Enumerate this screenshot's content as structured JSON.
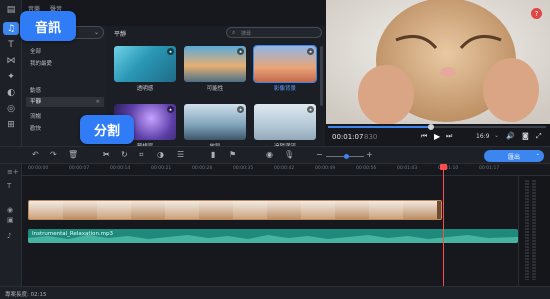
{
  "sidebar": {
    "tabs": [
      "音樂",
      "聲音"
    ],
    "categories": [
      "全部",
      "我的最愛",
      "動感",
      "平靜",
      "流暢",
      "歡快"
    ],
    "selected_category": "平靜"
  },
  "grid": {
    "title": "平靜",
    "search_placeholder": "搜尋",
    "items": [
      {
        "label": "透明感"
      },
      {
        "label": "可能性"
      },
      {
        "label": "影像背景"
      },
      {
        "label": "夢想家"
      },
      {
        "label": "放鬆"
      },
      {
        "label": "追隨潮流"
      }
    ]
  },
  "callouts": {
    "audio": "音訊",
    "split": "分割"
  },
  "player": {
    "time_current": "00:01:07",
    "time_frac": "830",
    "aspect": "16:9"
  },
  "toolbar": {
    "export_label": "匯出"
  },
  "ruler": {
    "ticks": [
      "00:00:00",
      "00:00:07",
      "00:00:14",
      "00:00:21",
      "00:00:28",
      "00:00:35",
      "00:00:42",
      "00:00:49",
      "00:00:56",
      "00:01:03",
      "00:01:10",
      "00:01:17"
    ]
  },
  "timeline": {
    "audio_clip_name": "Instrumental_Relaxation.mp3"
  },
  "status": {
    "project_length": "專案長度: 02:15"
  },
  "colors": {
    "accent": "#3d86f0",
    "callout": "#2f7cf6",
    "playhead": "#ff4b4b",
    "audio_clip": "#1f8a7b"
  }
}
